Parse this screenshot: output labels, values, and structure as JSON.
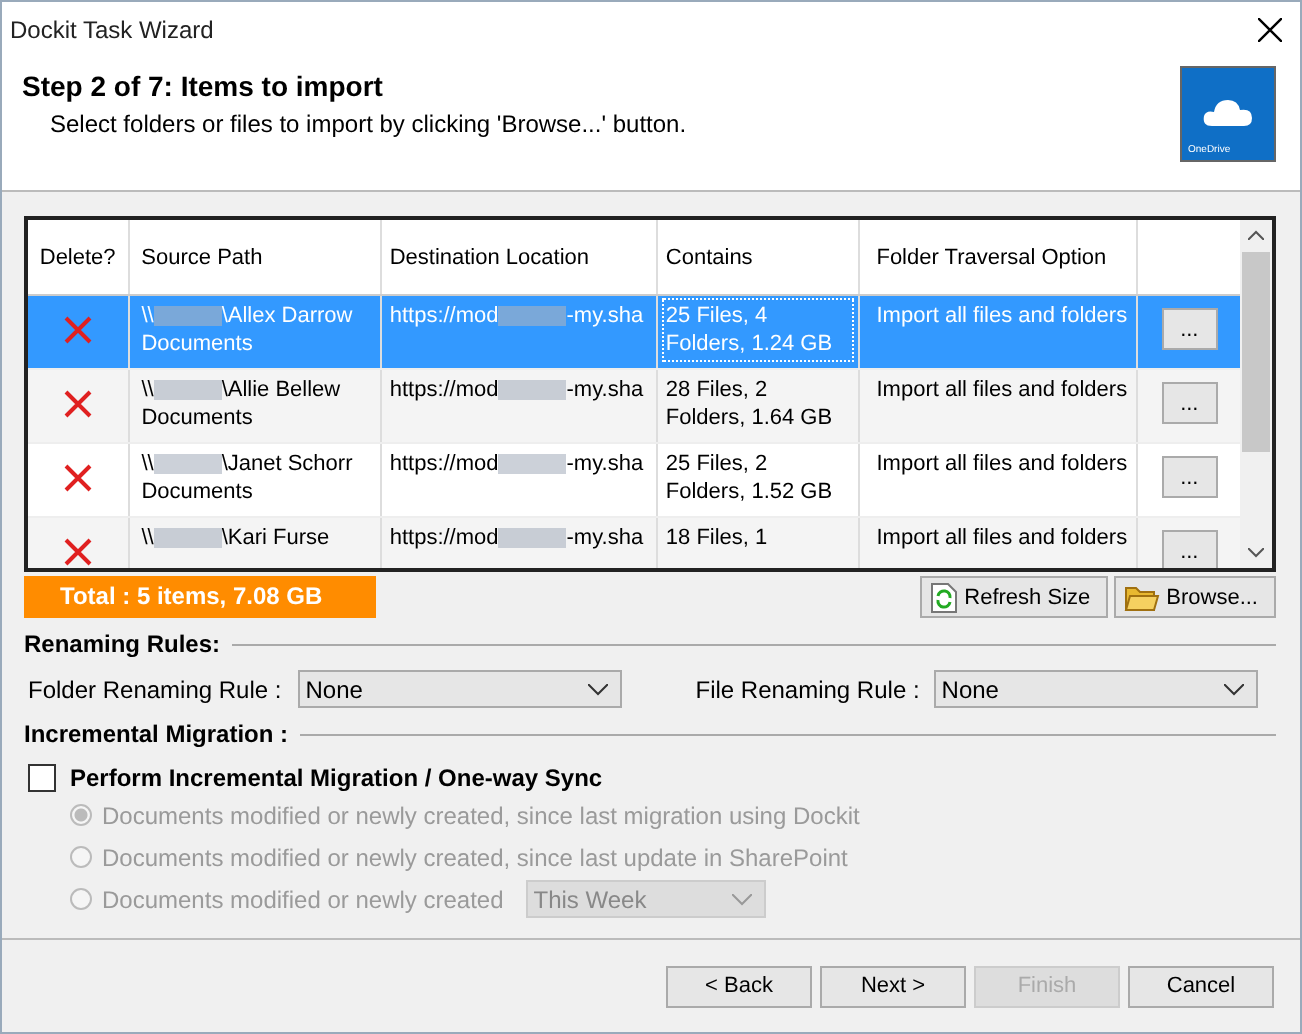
{
  "window": {
    "title": "Dockit Task Wizard"
  },
  "header": {
    "title": "Step 2 of 7: Items to import",
    "subtitle": "Select folders or files to import by clicking 'Browse...' button.",
    "logo_label": "OneDrive"
  },
  "table": {
    "columns": [
      "Delete?",
      "Source Path",
      "Destination Location",
      "Contains",
      "Folder Traversal Option"
    ],
    "rows": [
      {
        "selected": true,
        "source_prefix": "\\\\",
        "source_suffix": "\\Allex Darrow Documents",
        "dest_prefix": "https://mod",
        "dest_suffix": "-my.sha",
        "contains": "25 Files, 4 Folders, 1.24 GB",
        "traversal": "Import all files and folders",
        "button": "..."
      },
      {
        "selected": false,
        "source_prefix": "\\\\",
        "source_suffix": "\\Allie Bellew Documents",
        "dest_prefix": "https://mod",
        "dest_suffix": "-my.sha",
        "contains": "28 Files, 2 Folders, 1.64 GB",
        "traversal": "Import all files and folders",
        "button": "..."
      },
      {
        "selected": false,
        "source_prefix": "\\\\",
        "source_suffix": "\\Janet Schorr Documents",
        "dest_prefix": "https://mod",
        "dest_suffix": "-my.sha",
        "contains": "25 Files, 2 Folders, 1.52 GB",
        "traversal": "Import all files and folders",
        "button": "..."
      },
      {
        "selected": false,
        "source_prefix": "\\\\",
        "source_suffix": "\\Kari Furse",
        "dest_prefix": "https://mod",
        "dest_suffix": "-my.sha",
        "contains": "18 Files, 1",
        "traversal": "Import all files and folders",
        "button": "..."
      }
    ]
  },
  "total": "Total :  5 items, 7.08 GB",
  "actions": [
    "Refresh Size",
    "Browse..."
  ],
  "renaming": {
    "heading": "Renaming Rules:",
    "folder_label": "Folder Renaming Rule :",
    "folder_value": "None",
    "file_label": "File Renaming Rule :",
    "file_value": "None"
  },
  "incremental": {
    "heading": "Incremental Migration :",
    "checkbox": {
      "label": "Perform Incremental Migration / One-way Sync",
      "checked": false
    },
    "options": [
      {
        "label": "Documents modified or newly created, since last migration using Dockit",
        "selected": true,
        "disabled": true
      },
      {
        "label": "Documents modified or newly created, since last update in SharePoint",
        "selected": false,
        "disabled": true
      },
      {
        "label": "Documents modified or newly created",
        "selected": false,
        "disabled": true,
        "dropdown": "This Week"
      }
    ]
  },
  "footer": [
    {
      "label": "< Back",
      "disabled": false
    },
    {
      "label": "Next >",
      "disabled": false
    },
    {
      "label": "Finish",
      "disabled": true
    },
    {
      "label": "Cancel",
      "disabled": false
    }
  ]
}
